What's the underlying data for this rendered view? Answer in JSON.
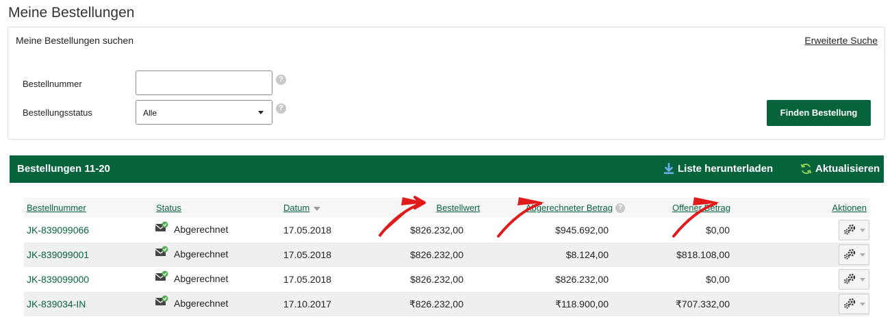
{
  "page": {
    "title": "Meine Bestellungen"
  },
  "search": {
    "heading": "Meine Bestellungen suchen",
    "advanced_link": "Erweiterte Suche",
    "order_number_label": "Bestellnummer",
    "order_number_value": "",
    "status_label": "Bestellungsstatus",
    "status_value": "Alle",
    "help_glyph": "?",
    "find_button": "Finden Bestellung"
  },
  "orders": {
    "title": "Bestellungen 11-20",
    "download_label": "Liste herunterladen",
    "refresh_label": "Aktualisieren",
    "columns": {
      "order_number": "Bestellnummer",
      "status": "Status",
      "date": "Datum",
      "order_value": "Bestellwert",
      "billed_amount": "Abgerechneter Betrag",
      "open_amount": "Offener Betrag",
      "actions": "Aktionen"
    },
    "rows": [
      {
        "order_number": "JK-839099066",
        "status": "Abgerechnet",
        "date": "17.05.2018",
        "order_value": "$826.232,00",
        "billed_amount": "$945.692,00",
        "open_amount": "$0,00"
      },
      {
        "order_number": "JK-839099001",
        "status": "Abgerechnet",
        "date": "17.05.2018",
        "order_value": "$826.232,00",
        "billed_amount": "$8.124,00",
        "open_amount": "$818.108,00"
      },
      {
        "order_number": "JK-839099000",
        "status": "Abgerechnet",
        "date": "17.05.2018",
        "order_value": "$826.232,00",
        "billed_amount": "$826.232,00",
        "open_amount": "$0,00"
      },
      {
        "order_number": "JK-839034-IN",
        "status": "Abgerechnet",
        "date": "17.10.2017",
        "order_value": "₹826.232,00",
        "billed_amount": "₹118.900,00",
        "open_amount": "₹707.332,00"
      }
    ]
  },
  "icons": {
    "help": "help-icon",
    "download": "download-icon",
    "refresh": "refresh-icon",
    "status": "envelope-check-icon",
    "actions": "gear-icon"
  },
  "colors": {
    "brand_green": "#07633b",
    "arrow_red": "#e01b1b"
  }
}
